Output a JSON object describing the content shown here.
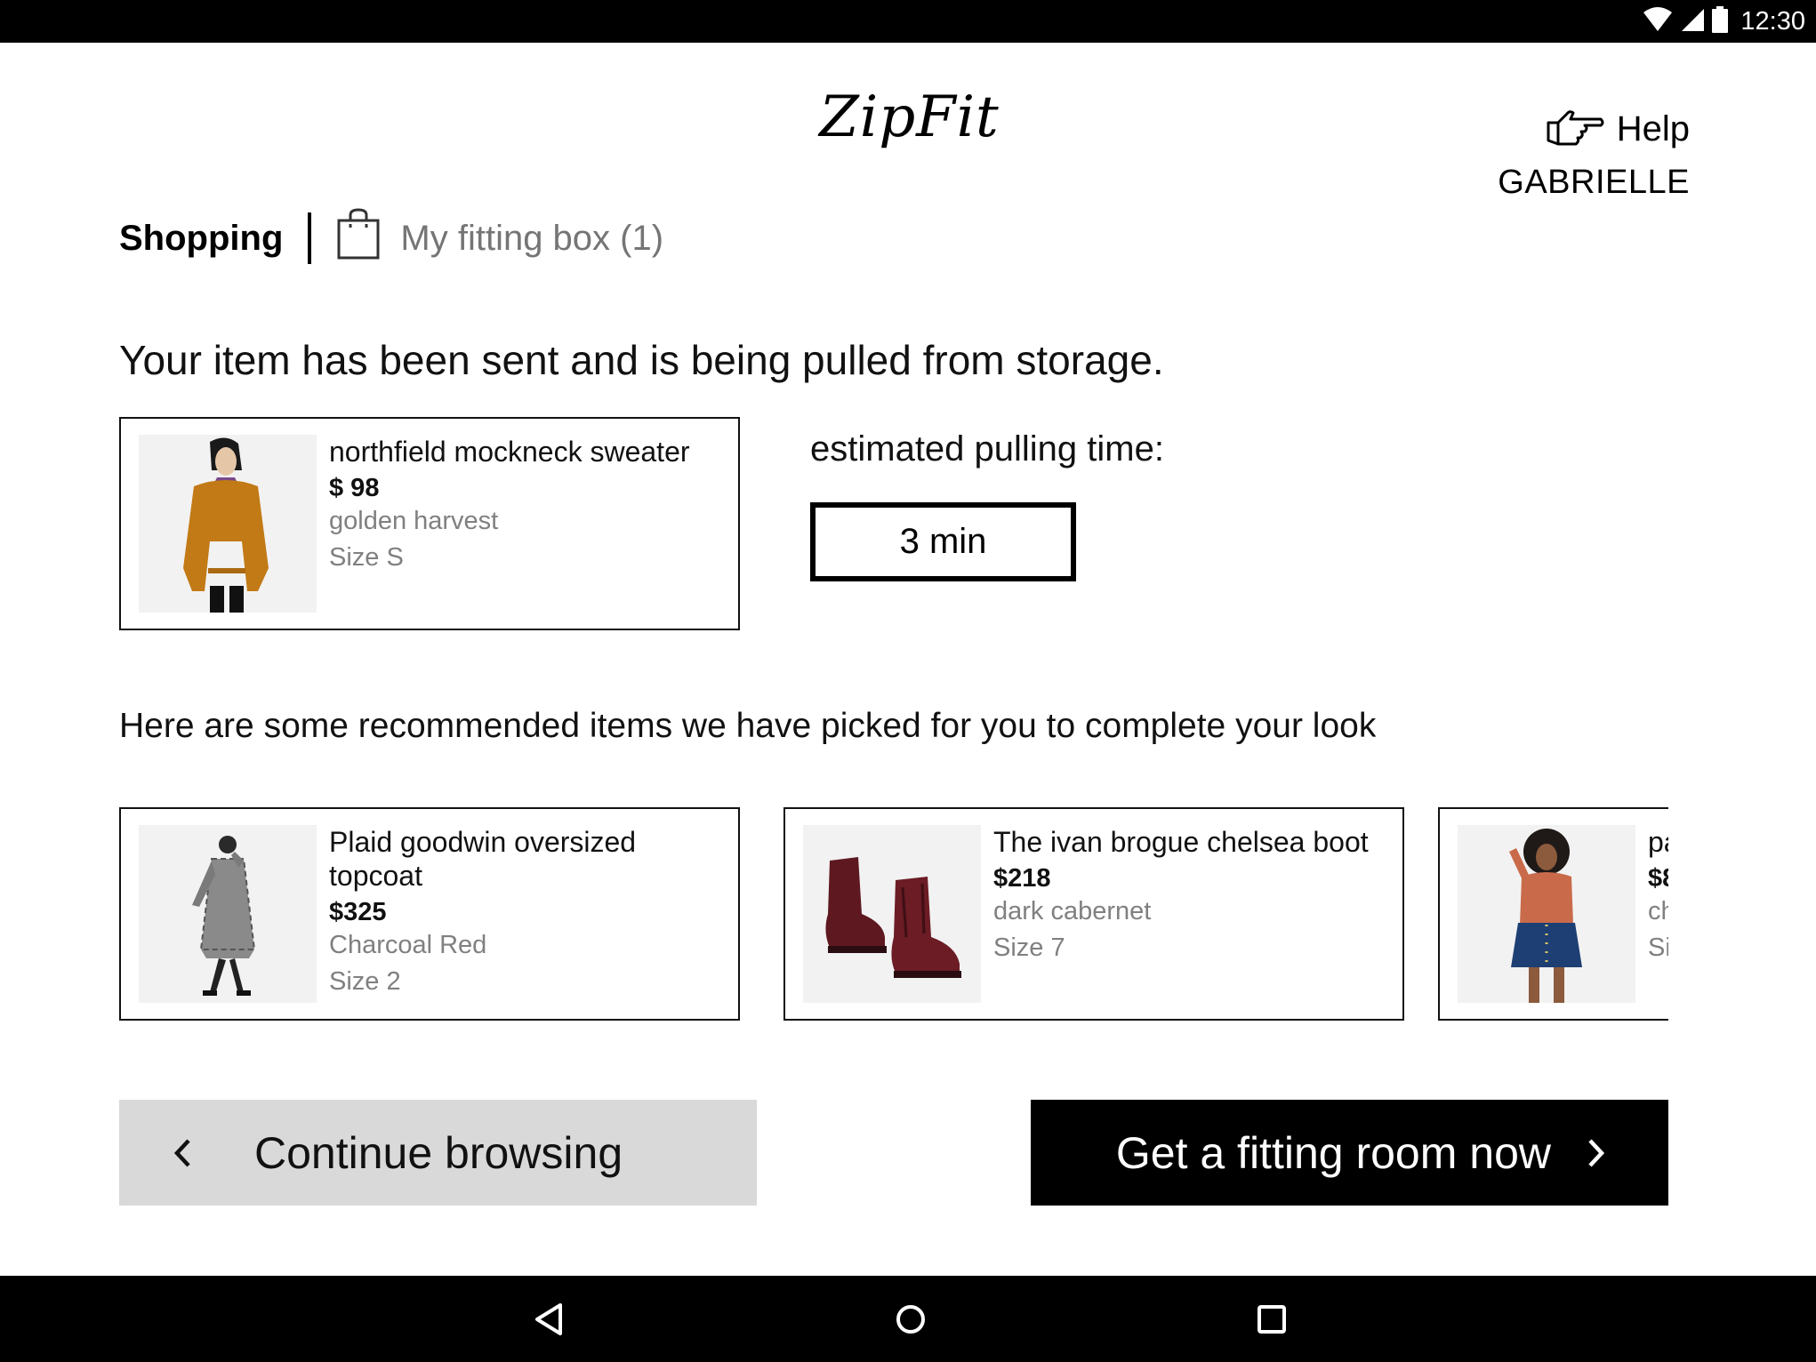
{
  "status_bar": {
    "time": "12:30",
    "icons": [
      "wifi-icon",
      "signal-icon",
      "battery-icon"
    ]
  },
  "header": {
    "brand": "ZipFit",
    "help_label": "Help",
    "user_name": "GABRIELLE"
  },
  "tabs": {
    "shopping": "Shopping",
    "fitting_box": "My fitting box (1)"
  },
  "sent_message": "Your item has been sent and is being pulled from storage.",
  "sent_item": {
    "name": "northfield mockneck sweater",
    "price": "$ 98",
    "color": "golden harvest",
    "size": "Size  S"
  },
  "pulling": {
    "label": "estimated pulling time:",
    "value": "3 min"
  },
  "recommend_message": "Here are some recommended items we have picked for you to complete your look",
  "recommendations": [
    {
      "name": "Plaid goodwin oversized topcoat",
      "price": "$325",
      "color": "Charcoal Red",
      "size": "Size  2"
    },
    {
      "name": "The ivan brogue chelsea boot",
      "price": "$218",
      "color": "dark cabernet",
      "size": "Size  7"
    },
    {
      "name": "pa",
      "price": "$8",
      "color": "ch",
      "size": "Si"
    }
  ],
  "buttons": {
    "continue": "Continue browsing",
    "fitting_room": "Get a fitting room now"
  },
  "nav": [
    "back-icon",
    "home-icon",
    "recents-icon"
  ],
  "colors": {
    "primary": "#000000",
    "secondary_button": "#d9d9d9",
    "muted_text": "#808080",
    "tab_inactive": "#757575"
  }
}
